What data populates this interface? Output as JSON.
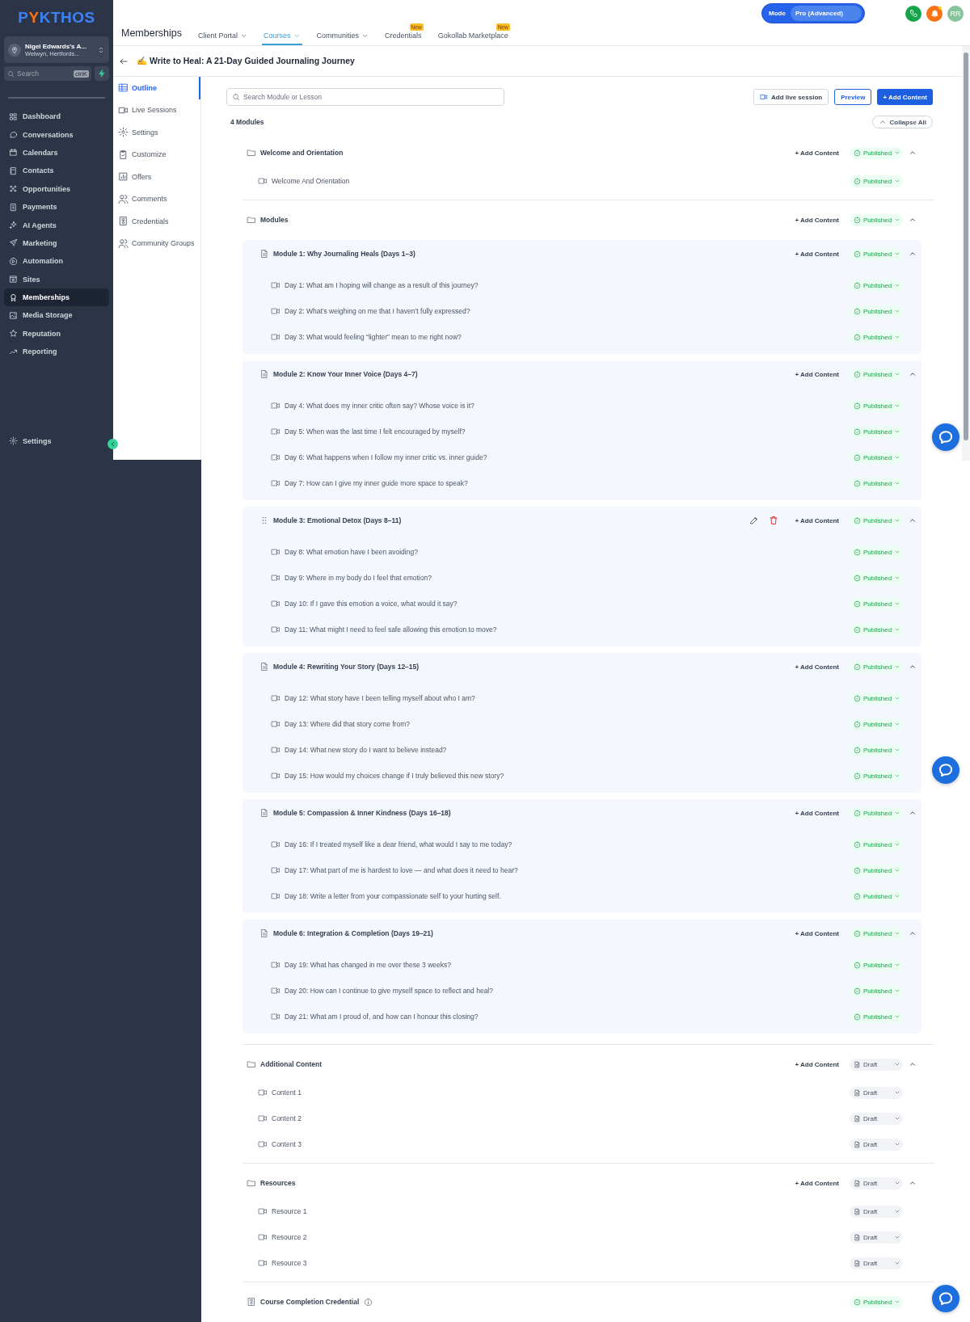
{
  "brand": {
    "logo": [
      {
        "text": "P",
        "color": "#3b82f6"
      },
      {
        "text": "Y",
        "color": "#f97316"
      },
      {
        "text": "KTHOS",
        "color": "#3b82f6"
      }
    ]
  },
  "account": {
    "name": "Nigel Edwards's A...",
    "location": "Welwyn, Hertfords..."
  },
  "sidebar_search": {
    "placeholder": "Search",
    "shortcut": "ctrlK"
  },
  "nav": [
    {
      "label": "Dashboard",
      "selected": false
    },
    {
      "label": "Conversations",
      "selected": false
    },
    {
      "label": "Calendars",
      "selected": false
    },
    {
      "label": "Contacts",
      "selected": false
    },
    {
      "label": "Opportunities",
      "selected": false
    },
    {
      "label": "Payments",
      "selected": false
    },
    {
      "label": "AI Agents",
      "selected": false
    },
    {
      "label": "Marketing",
      "selected": false
    },
    {
      "label": "Automation",
      "selected": false
    },
    {
      "label": "Sites",
      "selected": false
    },
    {
      "label": "Memberships",
      "selected": true
    },
    {
      "label": "Media Storage",
      "selected": false
    },
    {
      "label": "Reputation",
      "selected": false
    },
    {
      "label": "Reporting",
      "selected": false
    }
  ],
  "sidebar_settings": "Settings",
  "header": {
    "title": "Memberships",
    "tabs": [
      {
        "label": "Client Portal",
        "selected": false,
        "dropdown": true
      },
      {
        "label": "Courses",
        "selected": true,
        "dropdown": true
      },
      {
        "label": "Communities",
        "selected": false,
        "dropdown": true
      },
      {
        "label": "Credentials",
        "selected": false,
        "dropdown": false,
        "badge": "New"
      },
      {
        "label": "Gokollab Marketplace",
        "selected": false,
        "dropdown": false,
        "badge": "New"
      }
    ],
    "mode": {
      "label": "Mode",
      "value": "Pro (Advanced)"
    },
    "avatar": "RR"
  },
  "course": {
    "emoji": "✍",
    "title": "Write to Heal: A 21-Day Guided Journaling Journey"
  },
  "course_nav": [
    {
      "label": "Outline",
      "selected": true
    },
    {
      "label": "Live Sessions",
      "selected": false
    },
    {
      "label": "Settings",
      "selected": false
    },
    {
      "label": "Customize",
      "selected": false
    },
    {
      "label": "Offers",
      "selected": false
    },
    {
      "label": "Comments",
      "selected": false
    },
    {
      "label": "Credentials",
      "selected": false
    },
    {
      "label": "Community Groups",
      "selected": false
    }
  ],
  "toolbar": {
    "search_placeholder": "Search Module or Lesson",
    "live_session": "Add live session",
    "preview": "Preview",
    "add_content": "+ Add Content"
  },
  "module_count": "4 Modules",
  "collapse_all": "Collapse All",
  "sections": [
    {
      "kind": "folder",
      "title": "Welcome and Orientation",
      "add_label": "+ Add Content",
      "status": {
        "label": "Published",
        "kind": "published"
      },
      "expanded": true,
      "lessons": [
        {
          "title": "Welcome And Orientation",
          "status": {
            "label": "Published",
            "kind": "published"
          }
        }
      ]
    },
    {
      "kind": "folder",
      "title": "Modules",
      "add_label": "+ Add Content",
      "status": {
        "label": "Published",
        "kind": "published"
      },
      "expanded": true,
      "modules": [
        {
          "title": "Module 1: Why Journaling Heals (Days 1–3)",
          "hovered": false,
          "add_label": "+ Add Content",
          "status": {
            "label": "Published",
            "kind": "published"
          },
          "expanded": true,
          "lessons": [
            {
              "title": "Day 1: What am I hoping will change as a result of this journey?",
              "status": {
                "label": "Published",
                "kind": "published"
              }
            },
            {
              "title": "Day 2: What’s weighing on me that I haven’t fully expressed?",
              "status": {
                "label": "Published",
                "kind": "published"
              }
            },
            {
              "title": "Day 3: What would feeling “lighter” mean to me right now?",
              "status": {
                "label": "Published",
                "kind": "published"
              }
            }
          ]
        },
        {
          "title": "Module 2: Know Your Inner Voice (Days 4–7)",
          "hovered": false,
          "add_label": "+ Add Content",
          "status": {
            "label": "Published",
            "kind": "published"
          },
          "expanded": true,
          "lessons": [
            {
              "title": "Day 4: What does my inner critic often say? Whose voice is it?",
              "status": {
                "label": "Published",
                "kind": "published"
              }
            },
            {
              "title": "Day 5: When was the last time I felt encouraged by myself?",
              "status": {
                "label": "Published",
                "kind": "published"
              }
            },
            {
              "title": "Day 6: What happens when I follow my inner critic vs. inner guide?",
              "status": {
                "label": "Published",
                "kind": "published"
              }
            },
            {
              "title": "Day 7: How can I give my inner guide more space to speak?",
              "status": {
                "label": "Published",
                "kind": "published"
              }
            }
          ]
        },
        {
          "title": "Module 3: Emotional Detox (Days 8–11)",
          "hovered": true,
          "add_label": "+ Add Content",
          "status": {
            "label": "Published",
            "kind": "published"
          },
          "expanded": true,
          "lessons": [
            {
              "title": "Day 8: What emotion have I been avoiding?",
              "status": {
                "label": "Published",
                "kind": "published"
              }
            },
            {
              "title": "Day 9: Where in my body do I feel that emotion?",
              "status": {
                "label": "Published",
                "kind": "published"
              }
            },
            {
              "title": "Day 10: If I gave this emotion a voice, what would it say?",
              "status": {
                "label": "Published",
                "kind": "published"
              }
            },
            {
              "title": "Day 11: What might I need to feel safe allowing this emotion to move?",
              "status": {
                "label": "Published",
                "kind": "published"
              }
            }
          ]
        },
        {
          "title": "Module 4: Rewriting Your Story (Days 12–15)",
          "hovered": false,
          "add_label": "+ Add Content",
          "status": {
            "label": "Published",
            "kind": "published"
          },
          "expanded": true,
          "lessons": [
            {
              "title": "Day 12: What story have I been telling myself about who I am?",
              "status": {
                "label": "Published",
                "kind": "published"
              }
            },
            {
              "title": "Day 13: Where did that story come from?",
              "status": {
                "label": "Published",
                "kind": "published"
              }
            },
            {
              "title": "Day 14: What new story do I want to believe instead?",
              "status": {
                "label": "Published",
                "kind": "published"
              }
            },
            {
              "title": "Day 15: How would my choices change if I truly believed this new story?",
              "status": {
                "label": "Published",
                "kind": "published"
              }
            }
          ]
        },
        {
          "title": "Module 5: Compassion & Inner Kindness (Days 16–18)",
          "hovered": false,
          "add_label": "+ Add Content",
          "status": {
            "label": "Published",
            "kind": "published"
          },
          "expanded": true,
          "lessons": [
            {
              "title": "Day 16: If I treated myself like a dear friend, what would I say to me today?",
              "status": {
                "label": "Published",
                "kind": "published"
              }
            },
            {
              "title": "Day 17: What part of me is hardest to love — and what does it need to hear?",
              "status": {
                "label": "Published",
                "kind": "published"
              }
            },
            {
              "title": "Day 18: Write a letter from your compassionate self to your hurting self.",
              "status": {
                "label": "Published",
                "kind": "published"
              }
            }
          ]
        },
        {
          "title": "Module 6: Integration & Completion (Days 19–21)",
          "hovered": false,
          "add_label": "+ Add Content",
          "status": {
            "label": "Published",
            "kind": "published"
          },
          "expanded": true,
          "lessons": [
            {
              "title": "Day 19: What has changed in me over these 3 weeks?",
              "status": {
                "label": "Published",
                "kind": "published"
              }
            },
            {
              "title": "Day 20: How can I continue to give myself space to reflect and heal?",
              "status": {
                "label": "Published",
                "kind": "published"
              }
            },
            {
              "title": "Day 21: What am I proud of, and how can I honour this closing?",
              "status": {
                "label": "Published",
                "kind": "published"
              }
            }
          ]
        }
      ]
    },
    {
      "kind": "folder",
      "title": "Additional Content",
      "add_label": "+ Add Content",
      "status": {
        "label": "Draft",
        "kind": "draft"
      },
      "expanded": true,
      "lessons": [
        {
          "title": "Content 1",
          "status": {
            "label": "Draft",
            "kind": "draft"
          }
        },
        {
          "title": "Content 2",
          "status": {
            "label": "Draft",
            "kind": "draft"
          }
        },
        {
          "title": "Content 3",
          "status": {
            "label": "Draft",
            "kind": "draft"
          }
        }
      ]
    },
    {
      "kind": "folder",
      "title": "Resources",
      "add_label": "+ Add Content",
      "status": {
        "label": "Draft",
        "kind": "draft"
      },
      "expanded": true,
      "lessons": [
        {
          "title": "Resource 1",
          "status": {
            "label": "Draft",
            "kind": "draft"
          }
        },
        {
          "title": "Resource 2",
          "status": {
            "label": "Draft",
            "kind": "draft"
          }
        },
        {
          "title": "Resource 3",
          "status": {
            "label": "Draft",
            "kind": "draft"
          }
        }
      ]
    },
    {
      "kind": "credential",
      "title": "Course Completion Credential",
      "status": {
        "label": "Published",
        "kind": "published"
      }
    }
  ]
}
